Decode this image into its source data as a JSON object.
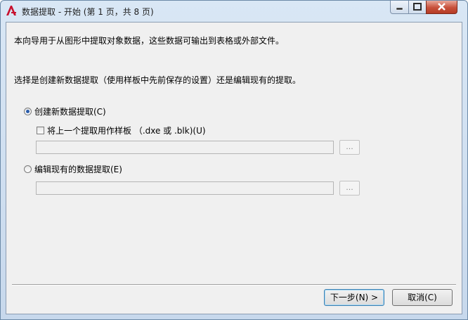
{
  "window": {
    "title": "数据提取 - 开始 (第 1 页，共 8 页)"
  },
  "intro": "本向导用于从图形中提取对象数据，这些数据可输出到表格或外部文件。",
  "prompt": "选择是创建新数据提取（使用样板中先前保存的设置）还是编辑现有的提取。",
  "options": {
    "create_new": {
      "label": "创建新数据提取(C)",
      "selected": true
    },
    "use_template": {
      "label": "将上一个提取用作样板 （.dxe 或 .blk)(U)",
      "checked": false,
      "path_value": "",
      "browse_label": "..."
    },
    "edit_existing": {
      "label": "编辑现有的数据提取(E)",
      "selected": false,
      "path_value": "",
      "browse_label": "..."
    }
  },
  "buttons": {
    "next": "下一步(N) >",
    "cancel": "取消(C)"
  }
}
